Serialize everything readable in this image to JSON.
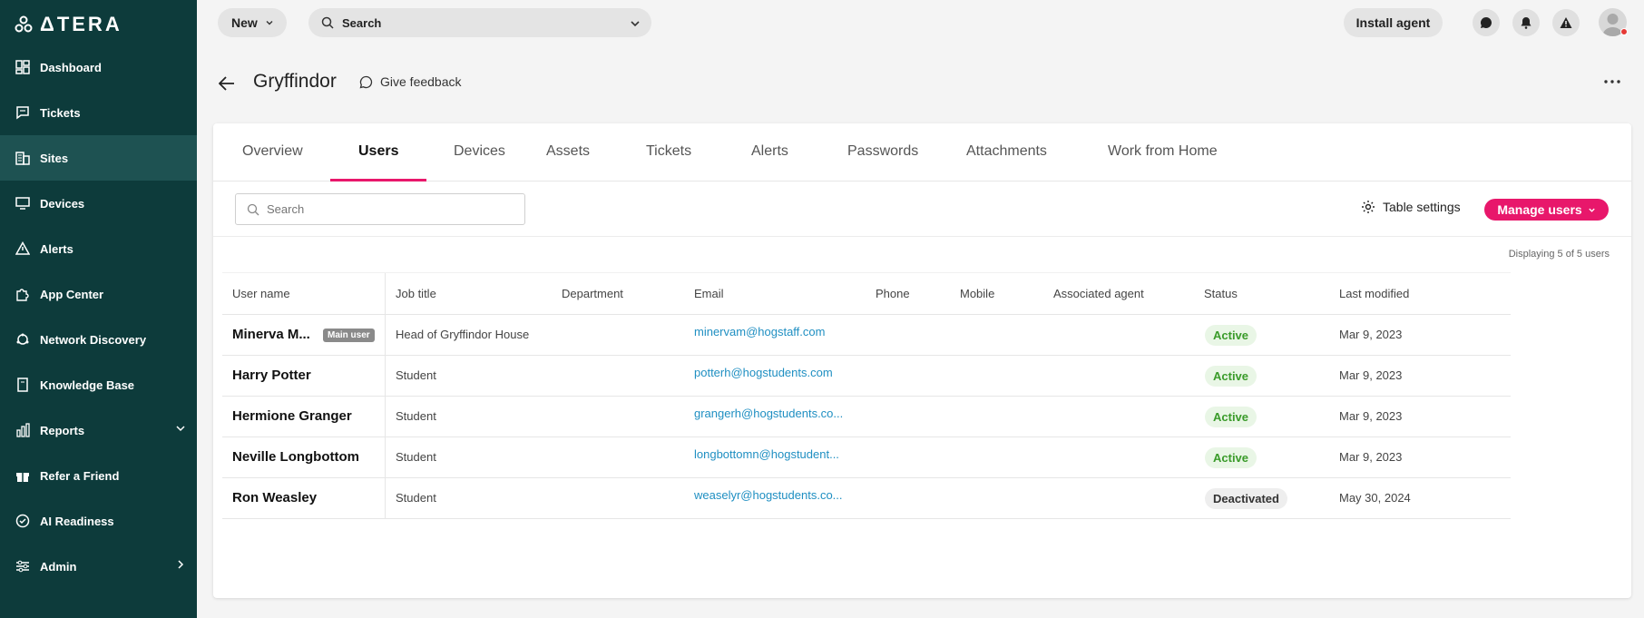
{
  "brand": {
    "logo_text": "ΔTERA"
  },
  "sidebar": {
    "items": [
      {
        "label": "Dashboard",
        "icon": "dashboard-icon"
      },
      {
        "label": "Tickets",
        "icon": "ticket-icon"
      },
      {
        "label": "Sites",
        "icon": "building-icon",
        "active": true
      },
      {
        "label": "Devices",
        "icon": "monitor-icon"
      },
      {
        "label": "Alerts",
        "icon": "alert-icon"
      },
      {
        "label": "App Center",
        "icon": "puzzle-icon"
      },
      {
        "label": "Network Discovery",
        "icon": "network-icon"
      },
      {
        "label": "Knowledge Base",
        "icon": "book-icon"
      },
      {
        "label": "Reports",
        "icon": "chart-icon"
      },
      {
        "label": "Refer a Friend",
        "icon": "gift-icon"
      },
      {
        "label": "AI Readiness",
        "icon": "check-circle-icon"
      },
      {
        "label": "Admin",
        "icon": "sliders-icon"
      }
    ]
  },
  "topbar": {
    "new_label": "New",
    "search_label": "Search",
    "install_agent_label": "Install agent"
  },
  "page": {
    "title": "Gryffindor",
    "feedback_label": "Give feedback"
  },
  "tabs": [
    "Overview",
    "Users",
    "Devices",
    "Assets",
    "Tickets",
    "Alerts",
    "Passwords",
    "Attachments",
    "Work from Home"
  ],
  "toolbar": {
    "search_placeholder": "Search",
    "table_settings_label": "Table settings",
    "manage_users_label": "Manage users",
    "displaying_text": "Displaying 5 of 5 users"
  },
  "table": {
    "columns": [
      "User name",
      "Job title",
      "Department",
      "Email",
      "Phone",
      "Mobile",
      "Associated agent",
      "Status",
      "Last modified"
    ],
    "main_user_badge": "Main user",
    "rows": [
      {
        "name": "Minerva M...",
        "job": "Head of Gryffindor House",
        "department": "",
        "email": "minervam@hogstaff.com",
        "phone": "",
        "mobile": "",
        "agent": "",
        "status": "Active",
        "modified": "Mar 9, 2023"
      },
      {
        "name": "Harry Potter",
        "job": "Student",
        "department": "",
        "email": "potterh@hogstudents.com",
        "phone": "",
        "mobile": "",
        "agent": "",
        "status": "Active",
        "modified": "Mar 9, 2023"
      },
      {
        "name": "Hermione Granger",
        "job": "Student",
        "department": "",
        "email": "grangerh@hogstudents.co...",
        "phone": "",
        "mobile": "",
        "agent": "",
        "status": "Active",
        "modified": "Mar 9, 2023"
      },
      {
        "name": "Neville Longbottom",
        "job": "Student",
        "department": "",
        "email": "longbottomn@hogstudent...",
        "phone": "",
        "mobile": "",
        "agent": "",
        "status": "Active",
        "modified": "Mar 9, 2023"
      },
      {
        "name": "Ron Weasley",
        "job": "Student",
        "department": "",
        "email": "weaselyr@hogstudents.co...",
        "phone": "",
        "mobile": "",
        "agent": "",
        "status": "Deactivated",
        "modified": "May 30, 2024"
      }
    ]
  },
  "colors": {
    "sidebar": "#0d3b3b",
    "accent": "#e8176b",
    "link": "#1f8fc2",
    "active_status": "#3a9b2a"
  }
}
